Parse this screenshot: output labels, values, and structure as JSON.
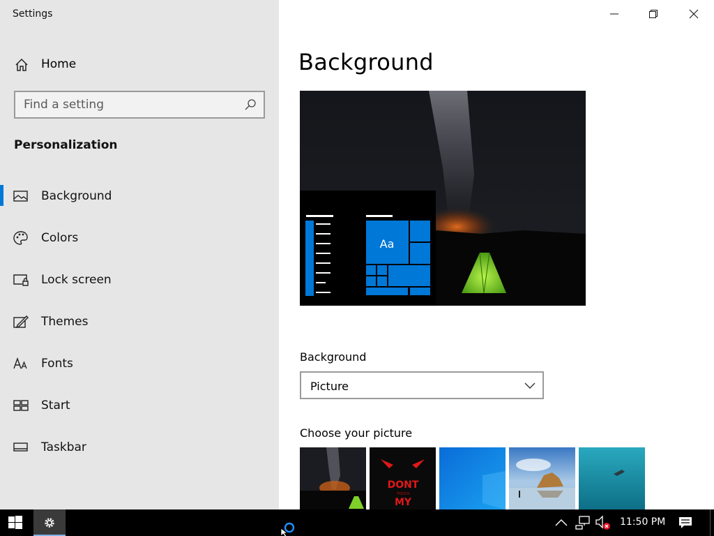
{
  "window": {
    "title": "Settings"
  },
  "sidebar": {
    "home_label": "Home",
    "search_placeholder": "Find a setting",
    "section_title": "Personalization",
    "items": [
      {
        "label": "Background",
        "icon": "picture-icon",
        "active": true
      },
      {
        "label": "Colors",
        "icon": "palette-icon"
      },
      {
        "label": "Lock screen",
        "icon": "lock-screen-icon"
      },
      {
        "label": "Themes",
        "icon": "themes-icon"
      },
      {
        "label": "Fonts",
        "icon": "fonts-icon"
      },
      {
        "label": "Start",
        "icon": "start-icon"
      },
      {
        "label": "Taskbar",
        "icon": "taskbar-icon"
      }
    ]
  },
  "main": {
    "title": "Background",
    "preview": {
      "tile_text": "Aa"
    },
    "background_label": "Background",
    "background_value": "Picture",
    "choose_label": "Choose your picture",
    "thumbnails": [
      {
        "name": "milky-way-tent",
        "text": ""
      },
      {
        "name": "red-eyes",
        "text_line1": "DONT",
        "text_line2": "TOUCH",
        "text_line3": "MY"
      },
      {
        "name": "windows-blue",
        "text": ""
      },
      {
        "name": "beach-rocks",
        "text": ""
      },
      {
        "name": "underwater-swimmer",
        "text": ""
      }
    ]
  },
  "taskbar": {
    "time": "11:50 PM"
  },
  "colors": {
    "accent": "#0078d7",
    "sidebar_bg": "#e6e6e6",
    "taskbar_bg": "#000000"
  }
}
